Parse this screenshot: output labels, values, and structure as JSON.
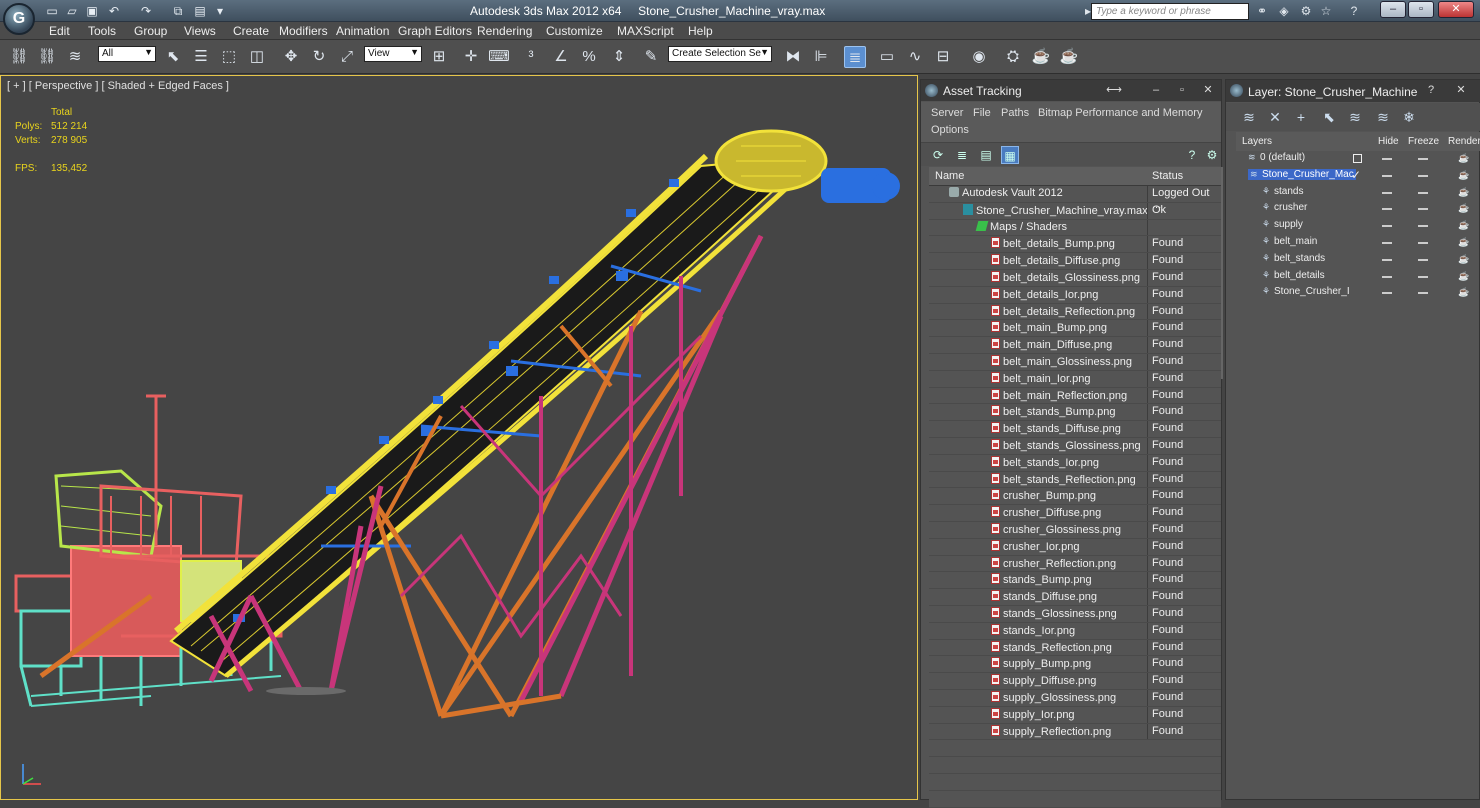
{
  "window": {
    "app_title": "Autodesk 3ds Max  2012 x64",
    "file_name": "Stone_Crusher_Machine_vray.max",
    "search_placeholder": "Type a keyword or phrase"
  },
  "menu": [
    "Edit",
    "Tools",
    "Group",
    "Views",
    "Create",
    "Modifiers",
    "Animation",
    "Graph Editors",
    "Rendering",
    "Customize",
    "MAXScript",
    "Help"
  ],
  "toolbar": {
    "filter_value": "All",
    "coord_value": "View",
    "selection_set_value": "Create Selection Se"
  },
  "viewport": {
    "label": "[ + ] [ Perspective ] [ Shaded + Edged Faces ]",
    "stats_header": "Total",
    "polys_label": "Polys:",
    "polys_value": "512 214",
    "verts_label": "Verts:",
    "verts_value": "278 905",
    "fps_label": "FPS:",
    "fps_value": "135,452"
  },
  "asset_tracking": {
    "title": "Asset Tracking",
    "menu": [
      "Server",
      "File",
      "Paths",
      "Bitmap Performance and Memory",
      "Options"
    ],
    "col_name": "Name",
    "col_status": "Status",
    "rows": [
      {
        "name": "Autodesk Vault 2012",
        "status": "Logged Out ...",
        "kind": "vault"
      },
      {
        "name": "Stone_Crusher_Machine_vray.max",
        "status": "Ok",
        "kind": "max"
      },
      {
        "name": "Maps / Shaders",
        "status": "",
        "kind": "maps"
      },
      {
        "name": "belt_details_Bump.png",
        "status": "Found",
        "kind": "file"
      },
      {
        "name": "belt_details_Diffuse.png",
        "status": "Found",
        "kind": "file"
      },
      {
        "name": "belt_details_Glossiness.png",
        "status": "Found",
        "kind": "file"
      },
      {
        "name": "belt_details_Ior.png",
        "status": "Found",
        "kind": "file"
      },
      {
        "name": "belt_details_Reflection.png",
        "status": "Found",
        "kind": "file"
      },
      {
        "name": "belt_main_Bump.png",
        "status": "Found",
        "kind": "file"
      },
      {
        "name": "belt_main_Diffuse.png",
        "status": "Found",
        "kind": "file"
      },
      {
        "name": "belt_main_Glossiness.png",
        "status": "Found",
        "kind": "file"
      },
      {
        "name": "belt_main_Ior.png",
        "status": "Found",
        "kind": "file"
      },
      {
        "name": "belt_main_Reflection.png",
        "status": "Found",
        "kind": "file"
      },
      {
        "name": "belt_stands_Bump.png",
        "status": "Found",
        "kind": "file"
      },
      {
        "name": "belt_stands_Diffuse.png",
        "status": "Found",
        "kind": "file"
      },
      {
        "name": "belt_stands_Glossiness.png",
        "status": "Found",
        "kind": "file"
      },
      {
        "name": "belt_stands_Ior.png",
        "status": "Found",
        "kind": "file"
      },
      {
        "name": "belt_stands_Reflection.png",
        "status": "Found",
        "kind": "file"
      },
      {
        "name": "crusher_Bump.png",
        "status": "Found",
        "kind": "file"
      },
      {
        "name": "crusher_Diffuse.png",
        "status": "Found",
        "kind": "file"
      },
      {
        "name": "crusher_Glossiness.png",
        "status": "Found",
        "kind": "file"
      },
      {
        "name": "crusher_Ior.png",
        "status": "Found",
        "kind": "file"
      },
      {
        "name": "crusher_Reflection.png",
        "status": "Found",
        "kind": "file"
      },
      {
        "name": "stands_Bump.png",
        "status": "Found",
        "kind": "file"
      },
      {
        "name": "stands_Diffuse.png",
        "status": "Found",
        "kind": "file"
      },
      {
        "name": "stands_Glossiness.png",
        "status": "Found",
        "kind": "file"
      },
      {
        "name": "stands_Ior.png",
        "status": "Found",
        "kind": "file"
      },
      {
        "name": "stands_Reflection.png",
        "status": "Found",
        "kind": "file"
      },
      {
        "name": "supply_Bump.png",
        "status": "Found",
        "kind": "file"
      },
      {
        "name": "supply_Diffuse.png",
        "status": "Found",
        "kind": "file"
      },
      {
        "name": "supply_Glossiness.png",
        "status": "Found",
        "kind": "file"
      },
      {
        "name": "supply_Ior.png",
        "status": "Found",
        "kind": "file"
      },
      {
        "name": "supply_Reflection.png",
        "status": "Found",
        "kind": "file"
      }
    ]
  },
  "layer_panel": {
    "title": "Layer: Stone_Crusher_Machine",
    "col_layers": "Layers",
    "col_hide": "Hide",
    "col_freeze": "Freeze",
    "col_render": "Render",
    "rows": [
      {
        "name": "0 (default)",
        "level": 0,
        "selected": false
      },
      {
        "name": "Stone_Crusher_Mac",
        "level": 0,
        "selected": true
      },
      {
        "name": "stands",
        "level": 1,
        "selected": false
      },
      {
        "name": "crusher",
        "level": 1,
        "selected": false
      },
      {
        "name": "supply",
        "level": 1,
        "selected": false
      },
      {
        "name": "belt_main",
        "level": 1,
        "selected": false
      },
      {
        "name": "belt_stands",
        "level": 1,
        "selected": false
      },
      {
        "name": "belt_details",
        "level": 1,
        "selected": false
      },
      {
        "name": "Stone_Crusher_I",
        "level": 1,
        "selected": false
      }
    ]
  },
  "colors": {
    "belt": "#f2e23a",
    "truss": "#c8357a",
    "truss_orange": "#d9742a",
    "crusher_red": "#e86060",
    "crusher_green": "#b8e64a",
    "stands_cyan": "#5fe0c8",
    "motor_blue": "#2a6fe0",
    "selection_blue": "#3c68c8"
  }
}
